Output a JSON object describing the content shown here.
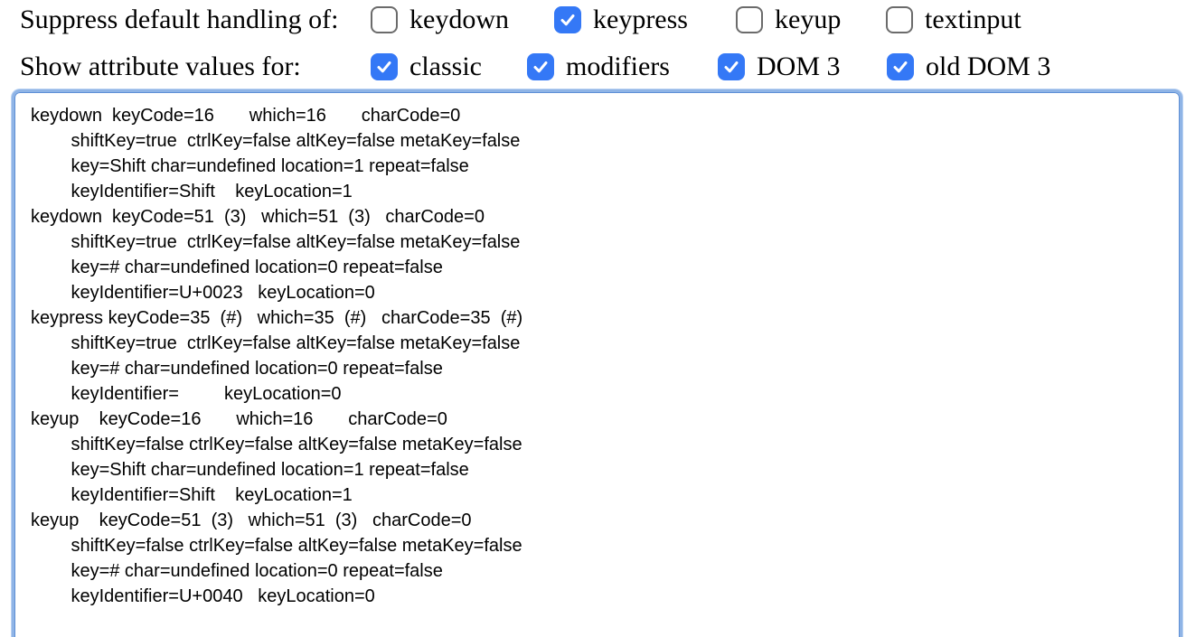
{
  "suppress": {
    "label": "Suppress default handling of:",
    "options": [
      {
        "label": "keydown",
        "checked": false
      },
      {
        "label": "keypress",
        "checked": true
      },
      {
        "label": "keyup",
        "checked": false
      },
      {
        "label": "textinput",
        "checked": false
      }
    ]
  },
  "show": {
    "label": "Show attribute values for:",
    "options": [
      {
        "label": "classic",
        "checked": true
      },
      {
        "label": "modifiers",
        "checked": true
      },
      {
        "label": "DOM 3",
        "checked": true
      },
      {
        "label": "old DOM 3",
        "checked": true
      }
    ]
  },
  "colors": {
    "checkbox_checked": "#3478f6",
    "focus_ring": "#8fb4e6"
  },
  "log": {
    "lines": [
      "keydown  keyCode=16       which=16       charCode=0",
      "        shiftKey=true  ctrlKey=false altKey=false metaKey=false",
      "        key=Shift char=undefined location=1 repeat=false",
      "        keyIdentifier=Shift    keyLocation=1",
      "keydown  keyCode=51  (3)   which=51  (3)   charCode=0",
      "        shiftKey=true  ctrlKey=false altKey=false metaKey=false",
      "        key=# char=undefined location=0 repeat=false",
      "        keyIdentifier=U+0023   keyLocation=0",
      "keypress keyCode=35  (#)   which=35  (#)   charCode=35  (#)",
      "        shiftKey=true  ctrlKey=false altKey=false metaKey=false",
      "        key=# char=undefined location=0 repeat=false",
      "        keyIdentifier=         keyLocation=0",
      "keyup    keyCode=16       which=16       charCode=0",
      "        shiftKey=false ctrlKey=false altKey=false metaKey=false",
      "        key=Shift char=undefined location=1 repeat=false",
      "        keyIdentifier=Shift    keyLocation=1",
      "keyup    keyCode=51  (3)   which=51  (3)   charCode=0",
      "        shiftKey=false ctrlKey=false altKey=false metaKey=false",
      "        key=# char=undefined location=0 repeat=false",
      "        keyIdentifier=U+0040   keyLocation=0"
    ]
  }
}
